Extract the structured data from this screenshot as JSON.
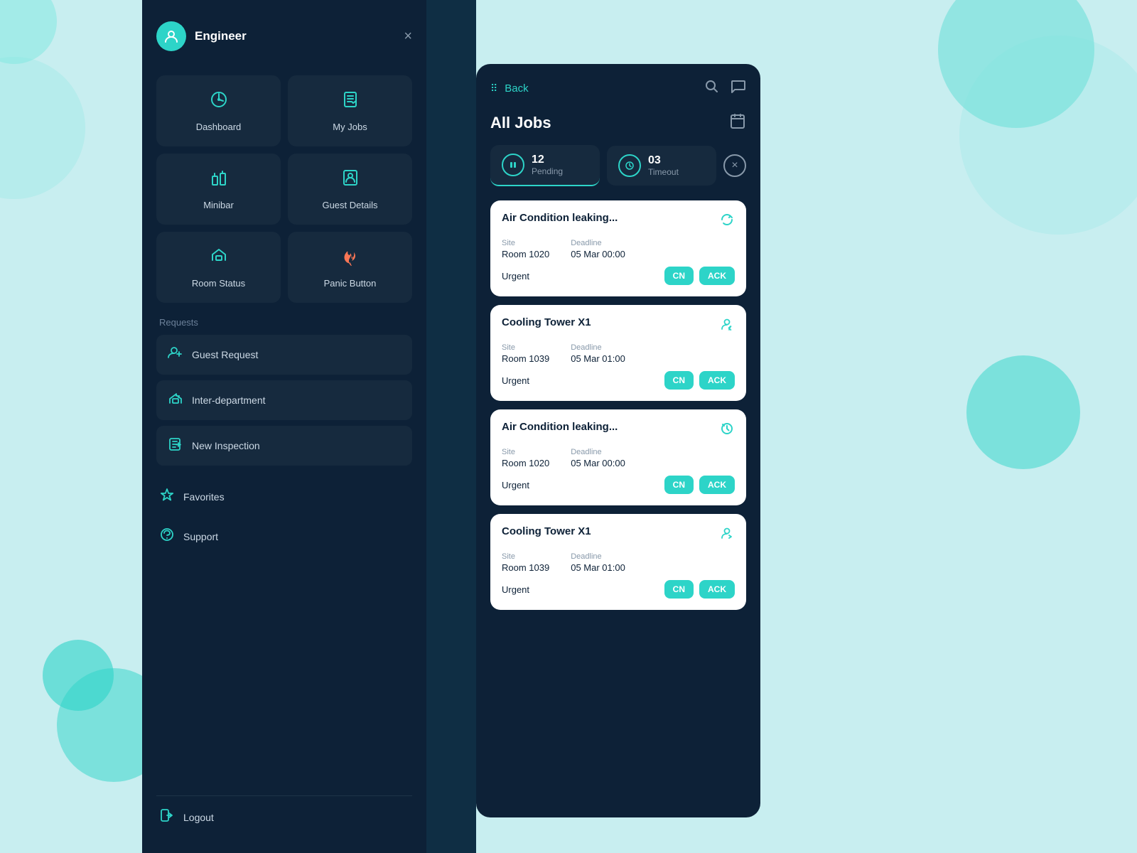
{
  "background": {
    "color": "#c8eef0"
  },
  "left_panel": {
    "user": {
      "name": "Engineer",
      "avatar_color": "#2dd4c8"
    },
    "close_label": "×",
    "menu_items": [
      {
        "id": "dashboard",
        "label": "Dashboard",
        "icon": "dashboard"
      },
      {
        "id": "my-jobs",
        "label": "My Jobs",
        "icon": "jobs"
      },
      {
        "id": "minibar",
        "label": "Minibar",
        "icon": "minibar"
      },
      {
        "id": "guest-details",
        "label": "Guest Details",
        "icon": "guest"
      },
      {
        "id": "room-status",
        "label": "Room Status",
        "icon": "room"
      },
      {
        "id": "panic-button",
        "label": "Panic Button",
        "icon": "fire"
      }
    ],
    "requests_label": "Requests",
    "request_items": [
      {
        "id": "guest-request",
        "label": "Guest Request"
      },
      {
        "id": "inter-department",
        "label": "Inter-department"
      },
      {
        "id": "new-inspection",
        "label": "New Inspection"
      }
    ],
    "bottom_links": [
      {
        "id": "favorites",
        "label": "Favorites"
      },
      {
        "id": "support",
        "label": "Support"
      }
    ],
    "logout_label": "Logout"
  },
  "right_panel": {
    "back_label": "Back",
    "title": "All Jobs",
    "status_tabs": [
      {
        "id": "pending",
        "count": "12",
        "label": "Pending",
        "icon": "pause"
      },
      {
        "id": "timeout",
        "count": "03",
        "label": "Timeout",
        "icon": "clock"
      }
    ],
    "close_tab_label": "×",
    "job_cards": [
      {
        "id": "card-1",
        "title": "Air Condition leaking...",
        "icon_type": "refresh",
        "site_label": "Site",
        "site_value": "Room 1020",
        "deadline_label": "Deadline",
        "deadline_value": "05 Mar 00:00",
        "urgency": "Urgent",
        "cn_label": "CN",
        "ack_label": "ACK"
      },
      {
        "id": "card-2",
        "title": "Cooling Tower X1",
        "icon_type": "reassign",
        "site_label": "Site",
        "site_value": "Room 1039",
        "deadline_label": "Deadline",
        "deadline_value": "05 Mar 01:00",
        "urgency": "Urgent",
        "cn_label": "CN",
        "ack_label": "ACK"
      },
      {
        "id": "card-3",
        "title": "Air Condition leaking...",
        "icon_type": "refresh2",
        "site_label": "Site",
        "site_value": "Room 1020",
        "deadline_label": "Deadline",
        "deadline_value": "05 Mar 00:00",
        "urgency": "Urgent",
        "cn_label": "CN",
        "ack_label": "ACK"
      },
      {
        "id": "card-4",
        "title": "Cooling Tower X1",
        "icon_type": "reassign2",
        "site_label": "Site",
        "site_value": "Room 1039",
        "deadline_label": "Deadline",
        "deadline_value": "05 Mar 01:00",
        "urgency": "Urgent",
        "cn_label": "CN",
        "ack_label": "ACK"
      }
    ]
  }
}
